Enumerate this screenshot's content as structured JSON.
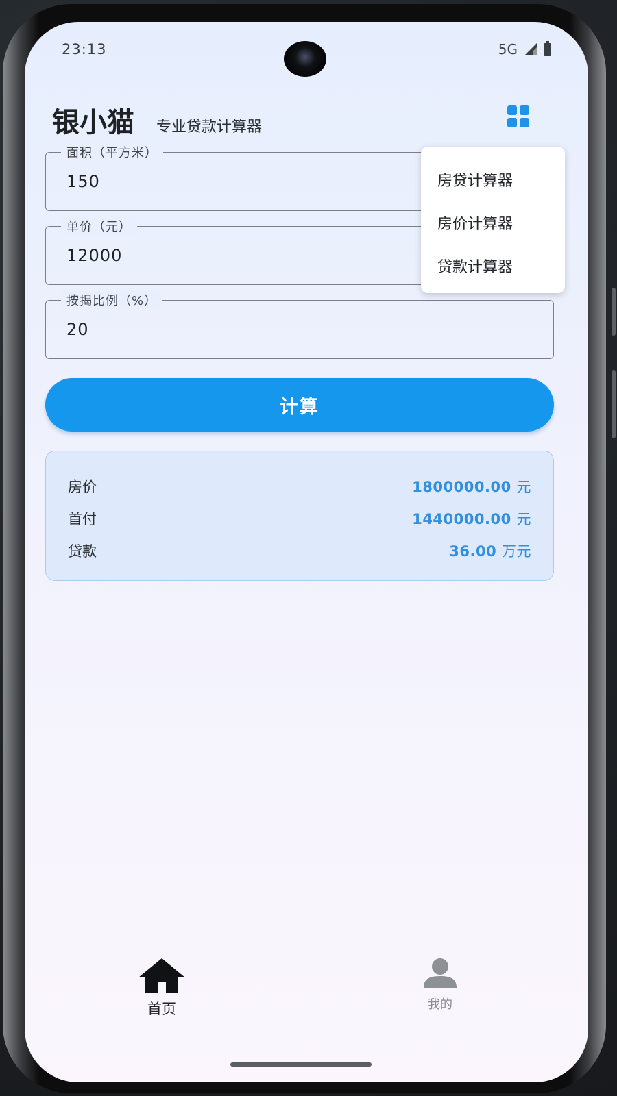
{
  "status_bar": {
    "time": "23:13",
    "network": "5G",
    "icons": [
      "signal-icon",
      "battery-icon"
    ]
  },
  "header": {
    "title": "银小猫",
    "subtitle": "专业贷款计算器",
    "menu_icon": "grid-icon",
    "accent_color": "#1f93ea"
  },
  "form": {
    "area": {
      "label": "面积（平方米）",
      "value": "150"
    },
    "unit_price": {
      "label": "单价（元）",
      "value": "12000"
    },
    "mortgage_ratio": {
      "label": "按揭比例（%）",
      "value": "20"
    }
  },
  "menu": {
    "items": [
      "房贷计算器",
      "房价计算器",
      "贷款计算器"
    ]
  },
  "calculate_button": {
    "label": "计算",
    "color": "#1597ee"
  },
  "results": {
    "rows": [
      {
        "label": "房价",
        "value": "1800000.00",
        "unit": "元"
      },
      {
        "label": "首付",
        "value": "1440000.00",
        "unit": "元"
      },
      {
        "label": "贷款",
        "value": "36.00",
        "unit": "万元"
      }
    ],
    "value_color": "#2f8fe0"
  },
  "bottom_nav": {
    "home": {
      "label": "首页",
      "icon": "home-icon"
    },
    "me": {
      "label": "我的",
      "icon": "person-icon"
    }
  }
}
